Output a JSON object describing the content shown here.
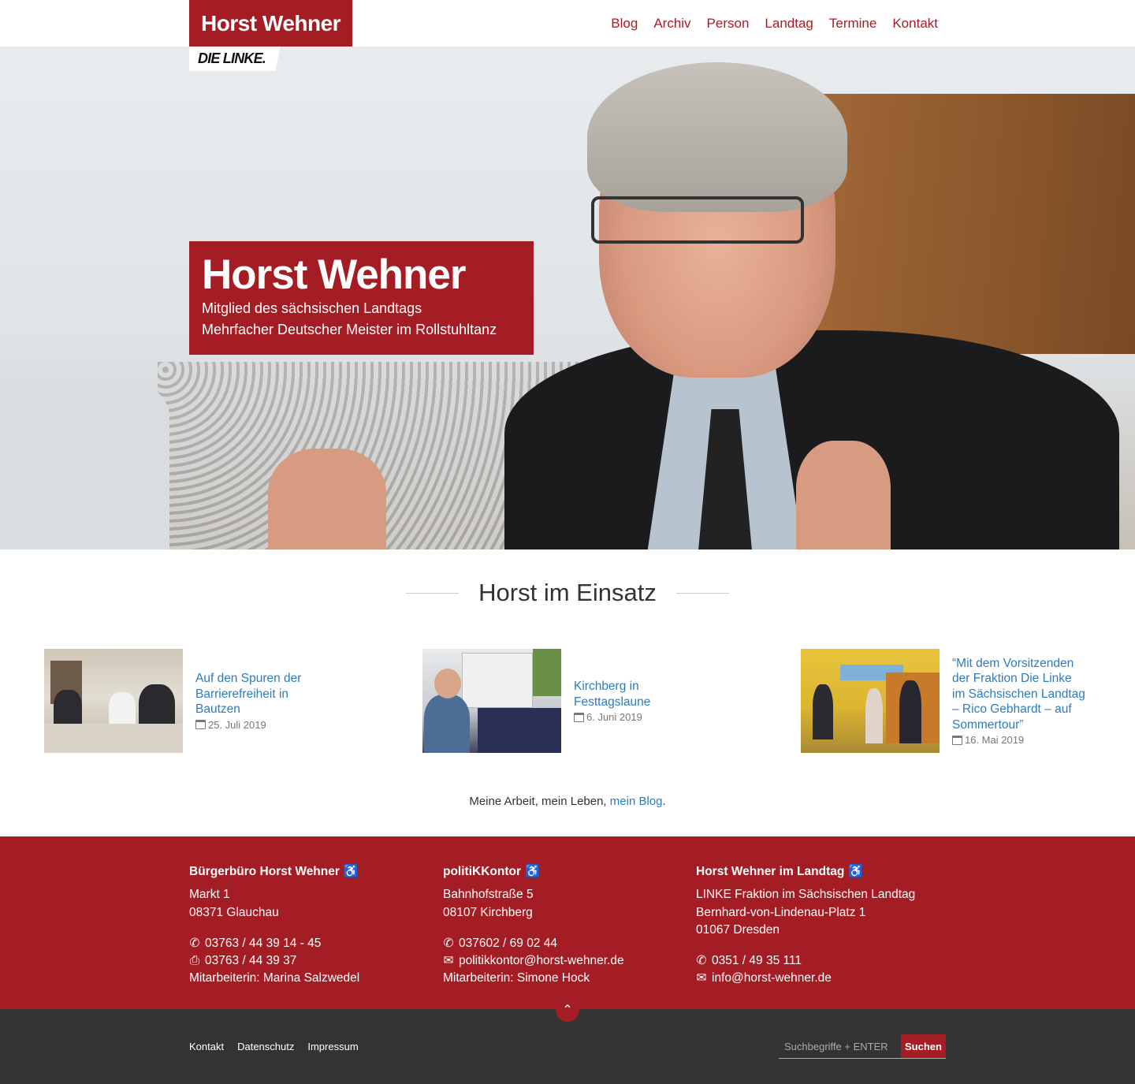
{
  "header": {
    "brand": "Horst Wehner",
    "party_logo": "DIE LINKE.",
    "nav": [
      "Blog",
      "Archiv",
      "Person",
      "Landtag",
      "Termine",
      "Kontakt"
    ]
  },
  "hero": {
    "title": "Horst Wehner",
    "line1": "Mitglied des sächsischen Landtags",
    "line2": "Mehrfacher Deutscher Meister im Rollstuhltanz"
  },
  "section": {
    "title": "Horst im Einsatz",
    "posts": [
      {
        "title": "Auf den Spuren der Barrierefreiheit in Bautzen",
        "date": "25. Juli 2019"
      },
      {
        "title": "Kirchberg in Festtagslaune",
        "date": "6. Juni 2019"
      },
      {
        "title": "“Mit dem Vorsitzenden der Fraktion Die Linke im Sächsischen Landtag – Rico Gebhardt – auf Sommertour”",
        "date": "16. Mai 2019"
      }
    ],
    "blog_note_prefix": "Meine Arbeit, mein Leben,",
    "blog_note_link": "mein Blog",
    "blog_note_suffix": "."
  },
  "contact": {
    "col1": {
      "title": "Bürgerbüro Horst Wehner",
      "street": "Markt 1",
      "city": "08371 Glauchau",
      "phone": "03763 / 44 39 14 - 45",
      "fax": "03763 / 44 39 37",
      "staff": "Mitarbeiterin: Marina Salzwedel"
    },
    "col2": {
      "title": "politiKKontor",
      "street": "Bahnhofstraße 5",
      "city": "08107 Kirchberg",
      "phone": "037602 / 69 02 44",
      "email": "politikkontor@horst-wehner.de",
      "staff": "Mitarbeiterin: Simone Hock"
    },
    "col3": {
      "title": "Horst Wehner im Landtag",
      "org": "LINKE Fraktion im Sächsischen Landtag",
      "street": "Bernhard-von-Lindenau-Platz 1",
      "city": "01067 Dresden",
      "phone": "0351 / 49 35 111",
      "email": "info@horst-wehner.de"
    }
  },
  "footer": {
    "links": [
      "Kontakt",
      "Datenschutz",
      "Impressum"
    ],
    "search_placeholder": "Suchbegriffe + ENTER",
    "search_button": "Suchen"
  },
  "colors": {
    "brand_red": "#a51d24",
    "link_blue": "#2d7bbf",
    "footer_dark": "#333333"
  },
  "icons": [
    "wheelchair-icon",
    "phone-icon",
    "fax-icon",
    "mail-icon",
    "calendar-icon",
    "chevron-up-icon"
  ]
}
